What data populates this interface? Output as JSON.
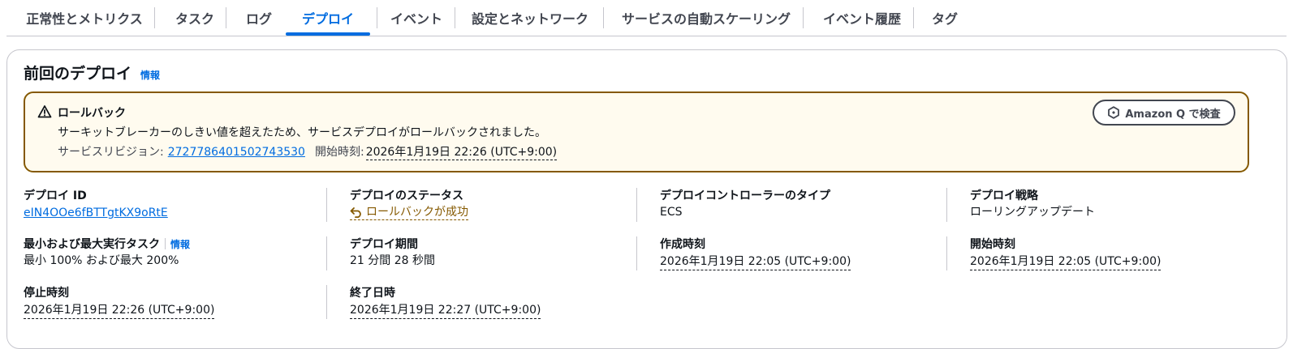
{
  "tabs": [
    {
      "label": "正常性とメトリクス",
      "active": false
    },
    {
      "label": "タスク",
      "active": false
    },
    {
      "label": "ログ",
      "active": false
    },
    {
      "label": "デプロイ",
      "active": true
    },
    {
      "label": "イベント",
      "active": false
    },
    {
      "label": "設定とネットワーク",
      "active": false
    },
    {
      "label": "サービスの自動スケーリング",
      "active": false
    },
    {
      "label": "イベント履歴",
      "active": false
    },
    {
      "label": "タグ",
      "active": false
    }
  ],
  "section": {
    "title": "前回のデプロイ",
    "info_label": "情報"
  },
  "alert": {
    "icon": "warning-icon",
    "title": "ロールバック",
    "message": "サーキットブレーカーのしきい値を超えたため、サービスデプロイがロールバックされました。",
    "revision_label": "サービスリビジョン:",
    "revision_value": "2727786401502743530",
    "start_label": "開始時刻:",
    "start_value": "2026年1月19日 22:26 (UTC+9:00)",
    "amazon_q_button": "Amazon Q で検査",
    "color": "#855900",
    "background": "#fffbef"
  },
  "details": {
    "deploy_id": {
      "label": "デプロイ ID",
      "value": "eIN4OOe6fBTTgtKX9oRtE"
    },
    "status": {
      "label": "デプロイのステータス",
      "value": "ロールバックが成功",
      "icon": "undo-icon"
    },
    "controller": {
      "label": "デプロイコントローラーのタイプ",
      "value": "ECS"
    },
    "strategy": {
      "label": "デプロイ戦略",
      "value": "ローリングアップデート"
    },
    "min_max_tasks": {
      "label": "最小および最大実行タスク",
      "info_label": "情報",
      "value": "最小 100% および最大 200%"
    },
    "duration": {
      "label": "デプロイ期間",
      "value": "21 分間 28 秒間"
    },
    "created_at": {
      "label": "作成時刻",
      "value": "2026年1月19日 22:05 (UTC+9:00)"
    },
    "started_at": {
      "label": "開始時刻",
      "value": "2026年1月19日 22:05 (UTC+9:00)"
    },
    "stopped_at": {
      "label": "停止時刻",
      "value": "2026年1月19日 22:26 (UTC+9:00)"
    },
    "ended_at": {
      "label": "終了日時",
      "value": "2026年1月19日 22:27 (UTC+9:00)"
    }
  },
  "colors": {
    "accent": "#006ce0",
    "text": "#0f141a",
    "muted": "#424650",
    "border": "#c6c6cd"
  }
}
